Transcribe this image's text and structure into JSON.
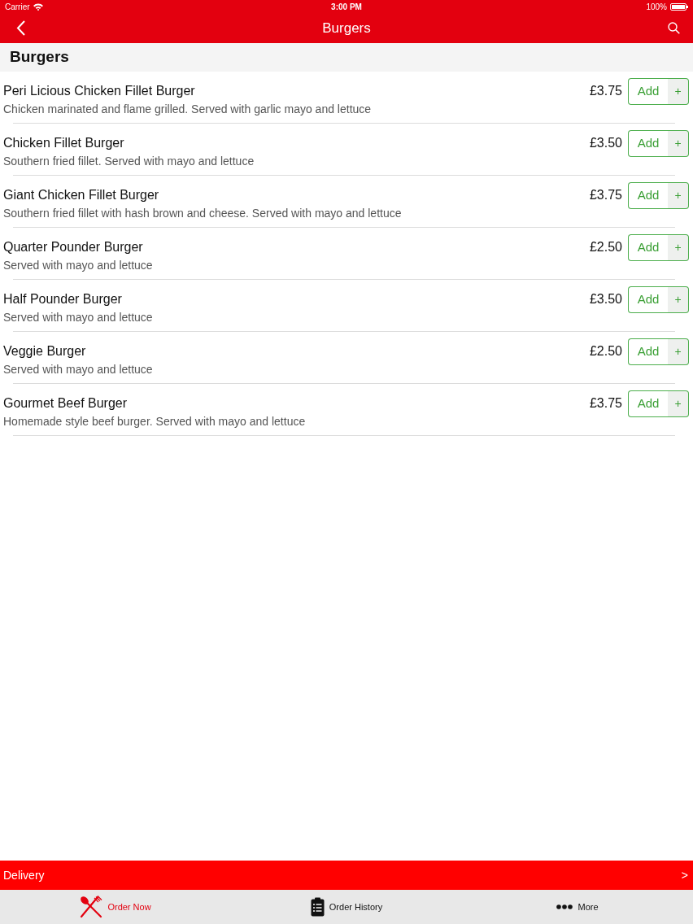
{
  "status_bar": {
    "carrier": "Carrier",
    "time": "3:00 PM",
    "battery": "100%"
  },
  "nav_bar": {
    "title": "Burgers"
  },
  "section": {
    "title": "Burgers"
  },
  "items": [
    {
      "name": "Peri Licious Chicken Fillet Burger",
      "description": "Chicken marinated and flame grilled. Served with garlic mayo and lettuce",
      "price": "£3.75",
      "button": "Add",
      "plus": "+"
    },
    {
      "name": "Chicken Fillet Burger",
      "description": "Southern fried fillet. Served with mayo and lettuce",
      "price": "£3.50",
      "button": "Add",
      "plus": "+"
    },
    {
      "name": "Giant Chicken Fillet Burger",
      "description": "Southern fried fillet with hash brown and cheese. Served with mayo and lettuce",
      "price": "£3.75",
      "button": "Add",
      "plus": "+"
    },
    {
      "name": "Quarter Pounder Burger",
      "description": "Served with mayo and lettuce",
      "price": "£2.50",
      "button": "Add",
      "plus": "+"
    },
    {
      "name": "Half Pounder Burger",
      "description": "Served with mayo and lettuce",
      "price": "£3.50",
      "button": "Add",
      "plus": "+"
    },
    {
      "name": "Veggie Burger",
      "description": "Served with mayo and lettuce",
      "price": "£2.50",
      "button": "Add",
      "plus": "+"
    },
    {
      "name": "Gourmet Beef Burger",
      "description": "Homemade style beef burger. Served with mayo and lettuce",
      "price": "£3.75",
      "button": "Add",
      "plus": "+"
    }
  ],
  "delivery_bar": {
    "label": "Delivery",
    "chevron": ">"
  },
  "tab_bar": [
    {
      "label": "Order Now",
      "kind": "utensils",
      "selected": true
    },
    {
      "label": "Order History",
      "kind": "clipboard",
      "selected": false
    },
    {
      "label": "More",
      "kind": "dots",
      "selected": false
    }
  ]
}
